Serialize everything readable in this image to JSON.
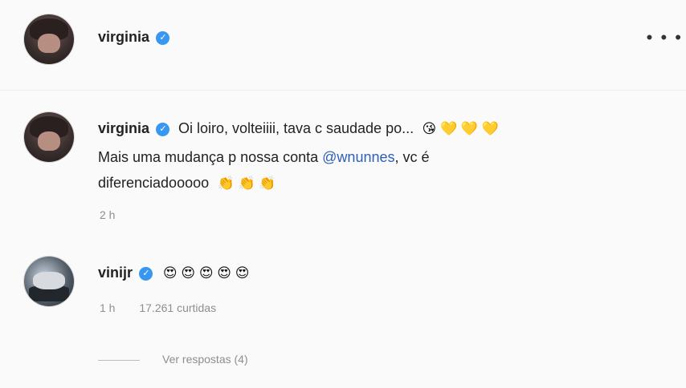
{
  "post_header": {
    "username": "virginia",
    "verified_icon": "verified-badge-icon",
    "more_icon": "more-options-icon",
    "more_glyph": "• • •"
  },
  "comments": [
    {
      "username": "virginia",
      "text_line1": "Oi loiro, volteiiii, tava c saudade po...",
      "emojis_line1": "😘 💛 💛 💛",
      "text_line2_prefix": "Mais uma mudança p nossa conta ",
      "mention": "@wnunnes",
      "text_line2_suffix": ", vc é",
      "text_line3": "diferenciadooooo",
      "emojis_line3": "👏 👏 👏",
      "time": "2 h"
    },
    {
      "username": "vinijr",
      "text": "😍 😍 😍 😍 😍",
      "time": "1 h",
      "likes": "17.261 curtidas"
    }
  ],
  "replies": {
    "label": "Ver respostas (4)"
  }
}
